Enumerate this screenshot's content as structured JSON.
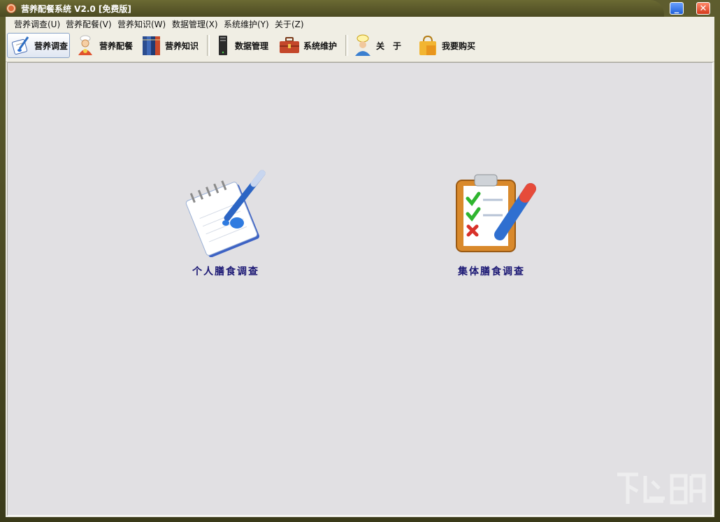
{
  "window": {
    "title": "营养配餐系统 V2.0 [免费版]",
    "minimize_glyph": "_",
    "close_glyph": "✕"
  },
  "menubar": {
    "items": [
      {
        "label": "营养调查(U)"
      },
      {
        "label": "营养配餐(V)"
      },
      {
        "label": "营养知识(W)"
      },
      {
        "label": "数据管理(X)"
      },
      {
        "label": "系统维护(Y)"
      },
      {
        "label": "关于(Z)"
      }
    ]
  },
  "toolbar": {
    "buttons": [
      {
        "label": "营养调查",
        "icon": "notepad-pen-icon",
        "active": true
      },
      {
        "label": "营养配餐",
        "icon": "chef-icon",
        "active": false
      },
      {
        "label": "营养知识",
        "icon": "books-icon",
        "active": false
      },
      {
        "label": "数据管理",
        "icon": "server-icon",
        "active": false
      },
      {
        "label": "系统维护",
        "icon": "toolbox-icon",
        "active": false
      },
      {
        "label": "关　于",
        "icon": "person-info-icon",
        "active": false
      },
      {
        "label": "我要购买",
        "icon": "shopping-bag-icon",
        "active": false
      }
    ]
  },
  "main": {
    "cards": [
      {
        "label": "个人膳食调查",
        "icon": "notepad-pen-icon"
      },
      {
        "label": "集体膳食调查",
        "icon": "clipboard-checklist-icon"
      }
    ]
  },
  "colors": {
    "frame": "#4b4a22",
    "workspace": "#e1e0e3",
    "caption": "#1b1874"
  }
}
